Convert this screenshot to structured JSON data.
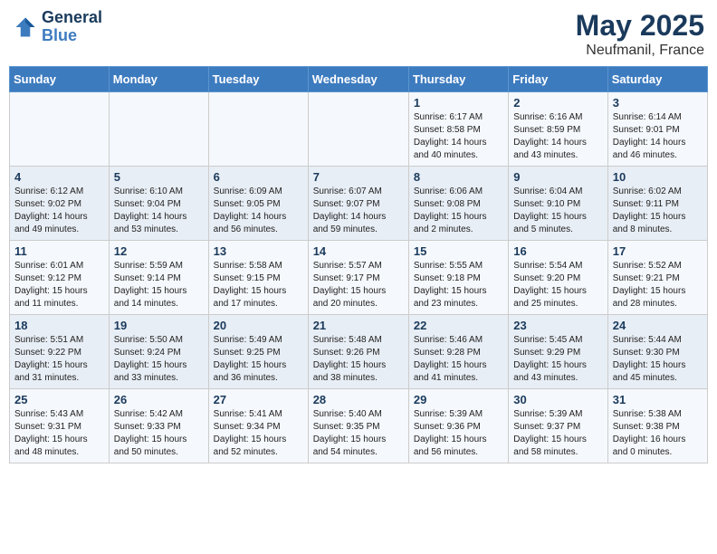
{
  "header": {
    "logo_line1": "General",
    "logo_line2": "Blue",
    "title": "May 2025",
    "subtitle": "Neufmanil, France"
  },
  "days_of_week": [
    "Sunday",
    "Monday",
    "Tuesday",
    "Wednesday",
    "Thursday",
    "Friday",
    "Saturday"
  ],
  "weeks": [
    [
      {
        "day": "",
        "info": ""
      },
      {
        "day": "",
        "info": ""
      },
      {
        "day": "",
        "info": ""
      },
      {
        "day": "",
        "info": ""
      },
      {
        "day": "1",
        "info": "Sunrise: 6:17 AM\nSunset: 8:58 PM\nDaylight: 14 hours\nand 40 minutes."
      },
      {
        "day": "2",
        "info": "Sunrise: 6:16 AM\nSunset: 8:59 PM\nDaylight: 14 hours\nand 43 minutes."
      },
      {
        "day": "3",
        "info": "Sunrise: 6:14 AM\nSunset: 9:01 PM\nDaylight: 14 hours\nand 46 minutes."
      }
    ],
    [
      {
        "day": "4",
        "info": "Sunrise: 6:12 AM\nSunset: 9:02 PM\nDaylight: 14 hours\nand 49 minutes."
      },
      {
        "day": "5",
        "info": "Sunrise: 6:10 AM\nSunset: 9:04 PM\nDaylight: 14 hours\nand 53 minutes."
      },
      {
        "day": "6",
        "info": "Sunrise: 6:09 AM\nSunset: 9:05 PM\nDaylight: 14 hours\nand 56 minutes."
      },
      {
        "day": "7",
        "info": "Sunrise: 6:07 AM\nSunset: 9:07 PM\nDaylight: 14 hours\nand 59 minutes."
      },
      {
        "day": "8",
        "info": "Sunrise: 6:06 AM\nSunset: 9:08 PM\nDaylight: 15 hours\nand 2 minutes."
      },
      {
        "day": "9",
        "info": "Sunrise: 6:04 AM\nSunset: 9:10 PM\nDaylight: 15 hours\nand 5 minutes."
      },
      {
        "day": "10",
        "info": "Sunrise: 6:02 AM\nSunset: 9:11 PM\nDaylight: 15 hours\nand 8 minutes."
      }
    ],
    [
      {
        "day": "11",
        "info": "Sunrise: 6:01 AM\nSunset: 9:12 PM\nDaylight: 15 hours\nand 11 minutes."
      },
      {
        "day": "12",
        "info": "Sunrise: 5:59 AM\nSunset: 9:14 PM\nDaylight: 15 hours\nand 14 minutes."
      },
      {
        "day": "13",
        "info": "Sunrise: 5:58 AM\nSunset: 9:15 PM\nDaylight: 15 hours\nand 17 minutes."
      },
      {
        "day": "14",
        "info": "Sunrise: 5:57 AM\nSunset: 9:17 PM\nDaylight: 15 hours\nand 20 minutes."
      },
      {
        "day": "15",
        "info": "Sunrise: 5:55 AM\nSunset: 9:18 PM\nDaylight: 15 hours\nand 23 minutes."
      },
      {
        "day": "16",
        "info": "Sunrise: 5:54 AM\nSunset: 9:20 PM\nDaylight: 15 hours\nand 25 minutes."
      },
      {
        "day": "17",
        "info": "Sunrise: 5:52 AM\nSunset: 9:21 PM\nDaylight: 15 hours\nand 28 minutes."
      }
    ],
    [
      {
        "day": "18",
        "info": "Sunrise: 5:51 AM\nSunset: 9:22 PM\nDaylight: 15 hours\nand 31 minutes."
      },
      {
        "day": "19",
        "info": "Sunrise: 5:50 AM\nSunset: 9:24 PM\nDaylight: 15 hours\nand 33 minutes."
      },
      {
        "day": "20",
        "info": "Sunrise: 5:49 AM\nSunset: 9:25 PM\nDaylight: 15 hours\nand 36 minutes."
      },
      {
        "day": "21",
        "info": "Sunrise: 5:48 AM\nSunset: 9:26 PM\nDaylight: 15 hours\nand 38 minutes."
      },
      {
        "day": "22",
        "info": "Sunrise: 5:46 AM\nSunset: 9:28 PM\nDaylight: 15 hours\nand 41 minutes."
      },
      {
        "day": "23",
        "info": "Sunrise: 5:45 AM\nSunset: 9:29 PM\nDaylight: 15 hours\nand 43 minutes."
      },
      {
        "day": "24",
        "info": "Sunrise: 5:44 AM\nSunset: 9:30 PM\nDaylight: 15 hours\nand 45 minutes."
      }
    ],
    [
      {
        "day": "25",
        "info": "Sunrise: 5:43 AM\nSunset: 9:31 PM\nDaylight: 15 hours\nand 48 minutes."
      },
      {
        "day": "26",
        "info": "Sunrise: 5:42 AM\nSunset: 9:33 PM\nDaylight: 15 hours\nand 50 minutes."
      },
      {
        "day": "27",
        "info": "Sunrise: 5:41 AM\nSunset: 9:34 PM\nDaylight: 15 hours\nand 52 minutes."
      },
      {
        "day": "28",
        "info": "Sunrise: 5:40 AM\nSunset: 9:35 PM\nDaylight: 15 hours\nand 54 minutes."
      },
      {
        "day": "29",
        "info": "Sunrise: 5:39 AM\nSunset: 9:36 PM\nDaylight: 15 hours\nand 56 minutes."
      },
      {
        "day": "30",
        "info": "Sunrise: 5:39 AM\nSunset: 9:37 PM\nDaylight: 15 hours\nand 58 minutes."
      },
      {
        "day": "31",
        "info": "Sunrise: 5:38 AM\nSunset: 9:38 PM\nDaylight: 16 hours\nand 0 minutes."
      }
    ]
  ]
}
